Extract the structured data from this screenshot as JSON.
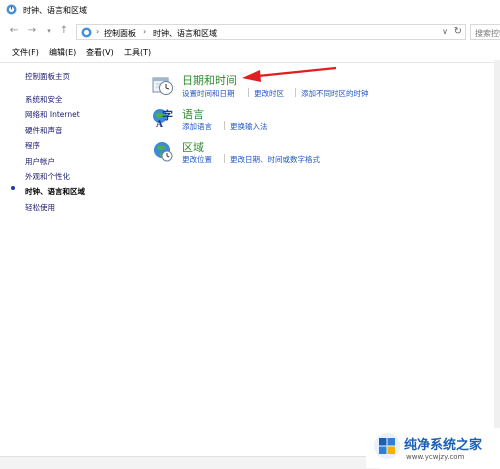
{
  "window": {
    "title": "时钟、语言和区域"
  },
  "nav": {
    "back_icon": "back-arrow-icon",
    "forward_icon": "forward-arrow-icon",
    "up_icon": "up-arrow-icon"
  },
  "address": {
    "crumbs": [
      "控制面板",
      "时钟、语言和区域"
    ],
    "separator": "›"
  },
  "search": {
    "placeholder": "搜索控制面"
  },
  "menu": [
    "文件(F)",
    "编辑(E)",
    "查看(V)",
    "工具(T)"
  ],
  "sidebar": {
    "home": "控制面板主页",
    "items": [
      "系统和安全",
      "网络和 Internet",
      "硬件和声音",
      "程序",
      "用户帐户",
      "外观和个性化",
      "时钟、语言和区域",
      "轻松使用"
    ],
    "current_index": 6
  },
  "categories": [
    {
      "title": "日期和时间",
      "icon": "clock-calendar-icon",
      "links": [
        "设置时间和日期",
        "更改时区",
        "添加不同时区的时钟"
      ]
    },
    {
      "title": "语言",
      "icon": "language-icon",
      "links": [
        "添加语言",
        "更换输入法"
      ]
    },
    {
      "title": "区域",
      "icon": "globe-clock-icon",
      "links": [
        "更改位置",
        "更改日期、时间或数字格式"
      ]
    }
  ],
  "annotation": {
    "type": "red-arrow",
    "color": "#e02020"
  },
  "watermark": {
    "brand": "纯净系统之家",
    "url": "www.ycwjzy.com"
  },
  "colors": {
    "category_title": "#2d8a2d",
    "link": "#1f56c7",
    "sidebar_link": "#1a1a6e"
  }
}
